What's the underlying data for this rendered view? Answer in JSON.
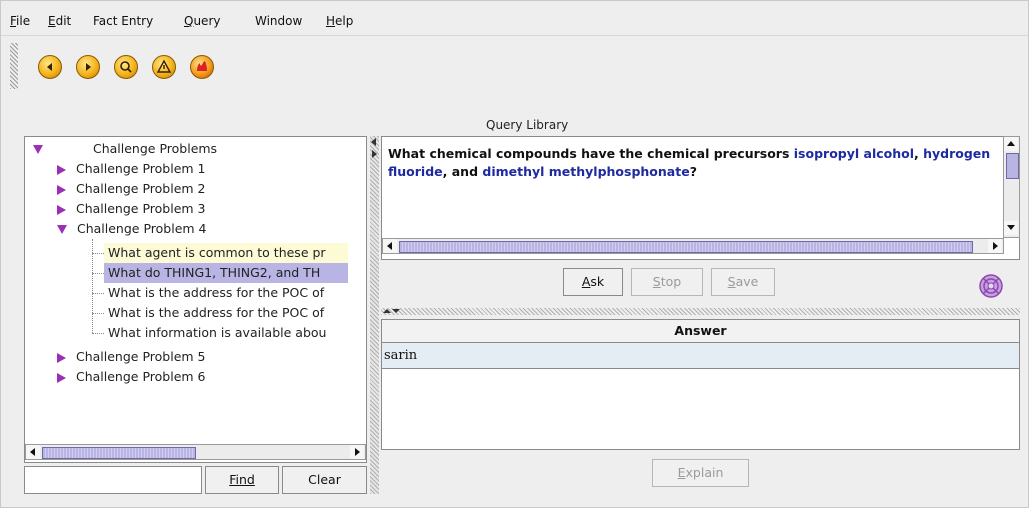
{
  "menubar": {
    "items": [
      {
        "label": "File",
        "mnemonic": "F",
        "rest": "ile"
      },
      {
        "label": "Edit",
        "mnemonic": "E",
        "rest": "dit"
      },
      {
        "label": "Fact Entry",
        "mnemonic": "",
        "rest": "Fact Entry"
      },
      {
        "label": "Query",
        "mnemonic": "Q",
        "rest": "uery"
      },
      {
        "label": "Window",
        "mnemonic": "",
        "rest": "Window"
      },
      {
        "label": "Help",
        "mnemonic": "H",
        "rest": "elp"
      }
    ]
  },
  "toolbar": {
    "buttons": [
      "back-icon",
      "forward-icon",
      "search-icon",
      "warning-icon",
      "flame-icon"
    ],
    "accent_color": "#f4b21a"
  },
  "query_library": {
    "title": "Query Library",
    "tree": {
      "root": "Challenge Problems",
      "problems": [
        "Challenge Problem 1",
        "Challenge Problem 2",
        "Challenge Problem 3",
        "Challenge Problem 4",
        "Challenge Problem 5",
        "Challenge Problem 6"
      ],
      "problem4_queries": [
        "What agent is common to these pr",
        "What do THING1, THING2, and TH",
        "What is the address for the POC of",
        "What is the address for the POC of",
        "What information is available abou"
      ]
    },
    "find_label": "Find",
    "clear_label": "Clear",
    "find_placeholder": ""
  },
  "query": {
    "text_parts": [
      {
        "text": "What chemical compounds have the chemical precursors ",
        "highlight": false
      },
      {
        "text": "isopropyl alcohol",
        "highlight": true
      },
      {
        "text": ", ",
        "highlight": false
      },
      {
        "text": "hydrogen fluoride",
        "highlight": true
      },
      {
        "text": ", and ",
        "highlight": false
      },
      {
        "text": "dimethyl methylphosphonate",
        "highlight": true
      },
      {
        "text": "?",
        "highlight": false
      }
    ],
    "highlight_color": "#1e2aa0"
  },
  "actions": {
    "ask": {
      "mnemonic": "A",
      "rest": "sk"
    },
    "stop": {
      "mnemonic": "S",
      "rest": "top"
    },
    "save": {
      "mnemonic": "S",
      "rest": "ave"
    },
    "explain": {
      "mnemonic": "E",
      "rest": "xplain"
    }
  },
  "answer": {
    "header": "Answer",
    "rows": [
      "sarin"
    ]
  }
}
